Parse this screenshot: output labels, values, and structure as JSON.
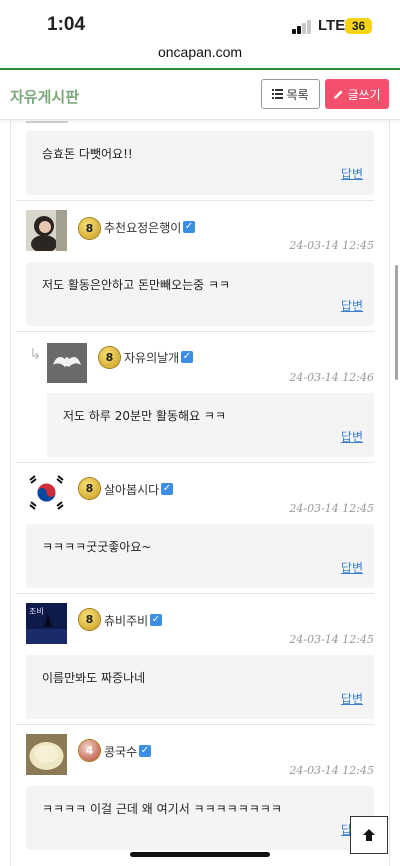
{
  "status": {
    "time": "1:04",
    "network": "LTE",
    "battery": "36"
  },
  "browser": {
    "url": "oncapan.com"
  },
  "header": {
    "title": "자유게시판",
    "list_label": "목록",
    "write_label": "글쓰기"
  },
  "comments": [
    {
      "text": "승효돈 다뺏어요!!",
      "reply": "답변"
    },
    {
      "level": "8",
      "name": "추천요정은행이",
      "date": "24-03-14 12:45",
      "text": "저도 활동은안하고 돈만빼오는중 ㅋㅋ",
      "reply": "답변"
    },
    {
      "level": "8",
      "name": "자유의날개",
      "date": "24-03-14 12:46",
      "text": "저도 하루 20분만 활동해요 ㅋㅋ",
      "reply": "답변"
    },
    {
      "level": "8",
      "name": "살아봅시다",
      "date": "24-03-14 12:45",
      "text": "ㅋㅋㅋㅋ굿굿좋아요~",
      "reply": "답변"
    },
    {
      "level": "8",
      "name": "츄비주비",
      "date": "24-03-14 12:45",
      "text": "이름만봐도 짜증나네",
      "reply": "답변"
    },
    {
      "level": "4",
      "name": "콩국수",
      "date": "24-03-14 12:45",
      "text": "ㅋㅋㅋㅋ 이걸 근데 왜 여기서 ㅋㅋㅋㅋㅋㅋㅋㅋ",
      "reply": "답변"
    }
  ],
  "colors": {
    "accent_green": "#2d8a3a",
    "write_button": "#f4506e",
    "link_blue": "#3a7fd0"
  }
}
